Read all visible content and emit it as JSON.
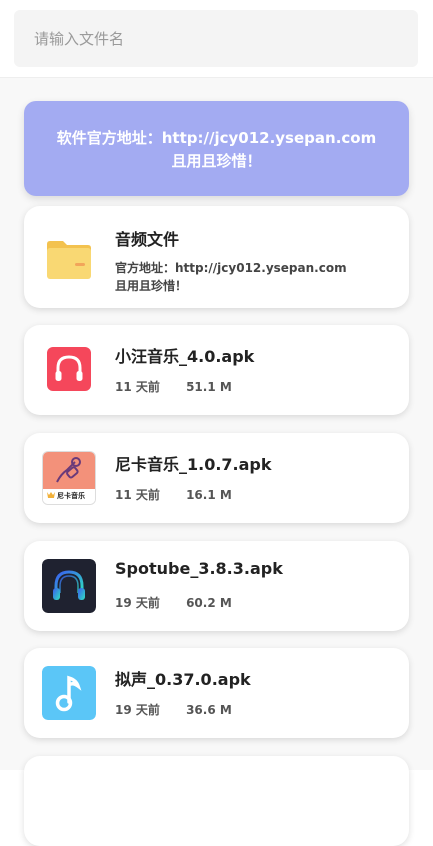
{
  "search": {
    "placeholder": "请输入文件名"
  },
  "banner": {
    "line1": "软件官方地址：http://jcy012.ysepan.com",
    "line2": "且用且珍惜！"
  },
  "folder": {
    "name": "音频文件",
    "desc_line1": "官方地址：http://jcy012.ysepan.com",
    "desc_line2": "且用且珍惜！",
    "icon": "folder-icon"
  },
  "files": [
    {
      "name": "小汪音乐_4.0.apk",
      "time": "11 天前",
      "size": "51.1 M",
      "icon": "headphones-app-icon"
    },
    {
      "name": "尼卡音乐_1.0.7.apk",
      "time": "11 天前",
      "size": "16.1 M",
      "icon": "nika-music-app-icon",
      "icon_caption": "尼卡音乐"
    },
    {
      "name": "Spotube_3.8.3.apk",
      "time": "19 天前",
      "size": "60.2 M",
      "icon": "spotube-app-icon"
    },
    {
      "name": "拟声_0.37.0.apk",
      "time": "19 天前",
      "size": "36.6 M",
      "icon": "music-note-app-icon"
    }
  ],
  "colors": {
    "banner_bg": "#a3abf2",
    "folder_yellow": "#f7d46a",
    "app1_red": "#f5475b",
    "app2_salmon": "#f3917a",
    "app3_dark": "#1f2230",
    "app4_blue": "#5bc6f7"
  }
}
